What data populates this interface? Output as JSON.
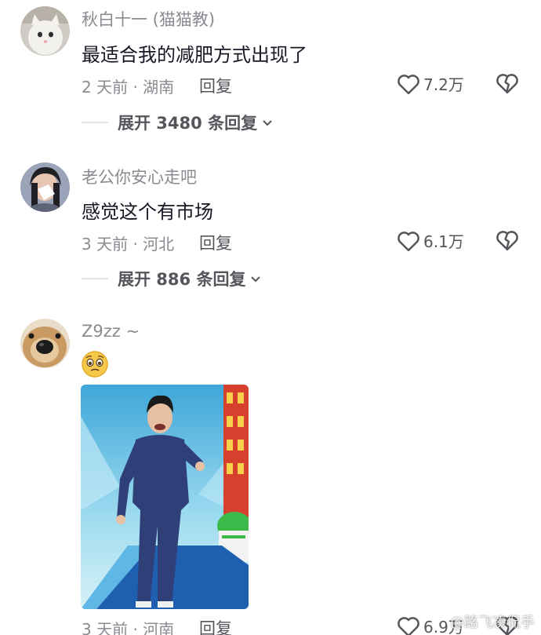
{
  "comments": [
    {
      "username": "秋白十一 (猫猫教)",
      "text": "最适合我的减肥方式出现了",
      "meta": "2 天前 · 湖南",
      "reply_label": "回复",
      "likes": "7.2万",
      "expand_label": "展开 3480 条回复"
    },
    {
      "username": "老公你安心走吧",
      "text": "感觉这个有市场",
      "meta": "3 天前 · 河北",
      "reply_label": "回复",
      "likes": "6.1万",
      "expand_label": "展开 886 条回复"
    },
    {
      "username": "Z9zz ~",
      "meta": "3 天前 · 河南",
      "reply_label": "回复",
      "likes": "6.9万"
    }
  ],
  "watermark": "@路飞凑侃手",
  "colors": {
    "text": "#161823",
    "secondary": "#8a8b91",
    "action": "#55565c"
  }
}
